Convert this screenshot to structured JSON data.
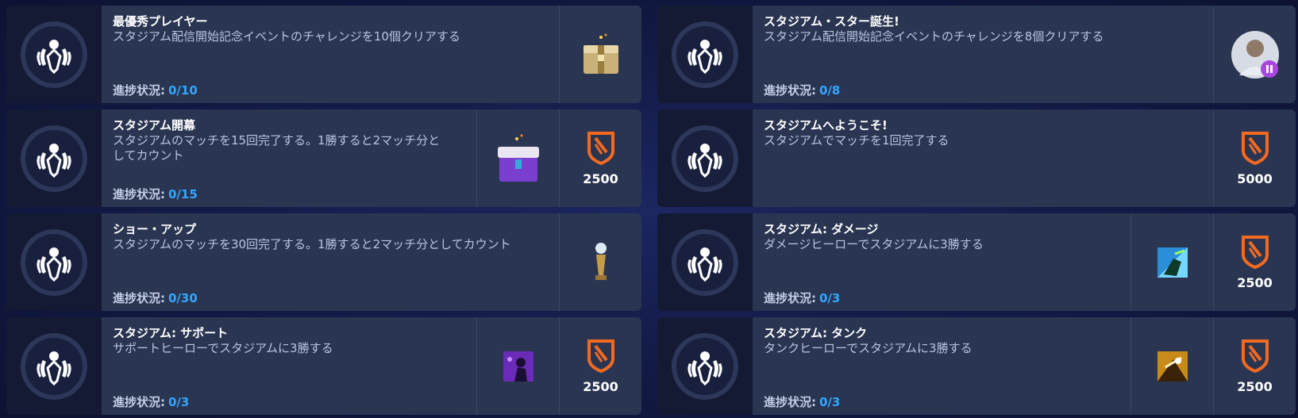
{
  "progress_label": "進捗状況:",
  "colors": {
    "accent": "#31a8ff",
    "card": "#2a3552",
    "shield": "#f26a21"
  },
  "left_challenges": [
    {
      "title": "最優秀プレイヤー",
      "desc": "スタジアム配信開始記念イベントのチャレンジを10個クリアする",
      "progress": "0/10",
      "rewards": [
        "lootbox-gold"
      ]
    },
    {
      "title": "スタジアム開幕",
      "desc": "スタジアムのマッチを15回完了する。1勝すると2マッチ分としてカウント",
      "progress": "0/15",
      "rewards": [
        "lootbox-purple",
        "2500"
      ]
    },
    {
      "title": "ショー・アップ",
      "desc": "スタジアムのマッチを30回完了する。1勝すると2マッチ分としてカウント",
      "progress": "0/30",
      "rewards": [
        "trophy"
      ]
    },
    {
      "title": "スタジアム: サポート",
      "desc": "サポートヒーローでスタジアムに3勝する",
      "progress": "0/3",
      "rewards": [
        "spray-purple",
        "2500"
      ]
    }
  ],
  "right_challenges": [
    {
      "title": "スタジアム・スター誕生!",
      "desc": "スタジアム配信開始記念イベントのチャレンジを8個クリアする",
      "progress": "0/8",
      "rewards": [
        "player-icon"
      ]
    },
    {
      "title": "スタジアムへようこそ!",
      "desc": "スタジアムでマッチを1回完了する",
      "progress": "",
      "rewards": [
        "5000"
      ]
    },
    {
      "title": "スタジアム: ダメージ",
      "desc": "ダメージヒーローでスタジアムに3勝する",
      "progress": "0/3",
      "rewards": [
        "spray-blue",
        "2500"
      ]
    },
    {
      "title": "スタジアム: タンク",
      "desc": "タンクヒーローでスタジアムに3勝する",
      "progress": "0/3",
      "rewards": [
        "spray-gold",
        "2500"
      ]
    }
  ]
}
